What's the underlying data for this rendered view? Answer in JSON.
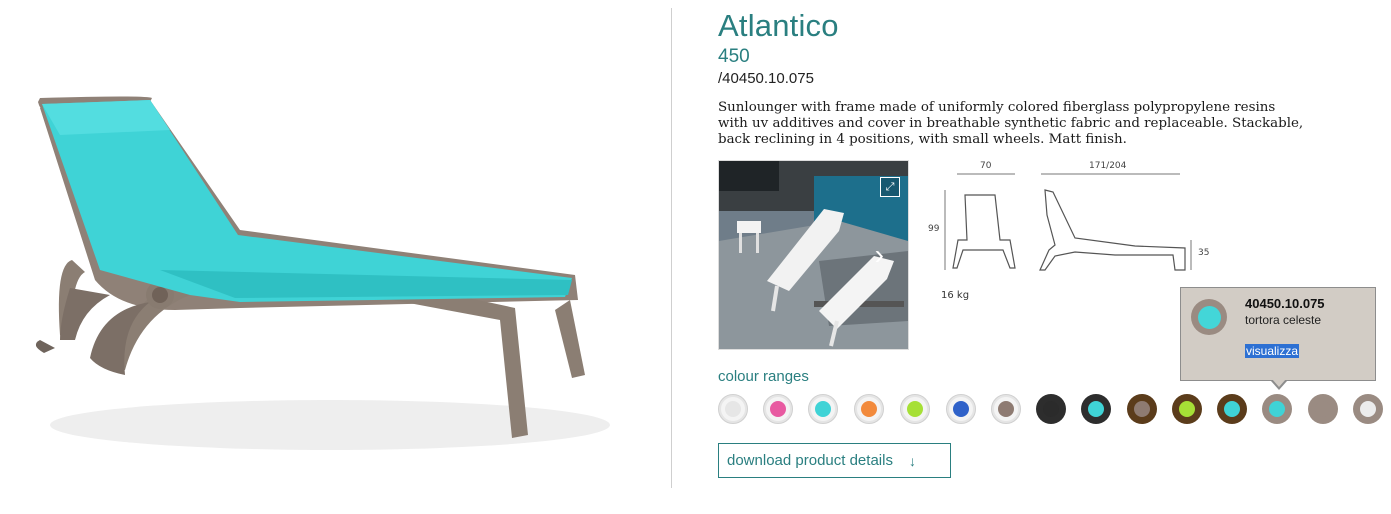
{
  "product": {
    "title": "Atlantico",
    "model": "450",
    "code": "/40450.10.075",
    "description": "Sunlounger with frame made of uniformly colored fiberglass polypropylene resins with uv additives and cover in breathable synthetic fabric and replaceable. Stackable, back reclining in 4 positions, with small wheels. Matt finish."
  },
  "dimensions": {
    "width": "70",
    "length": "171/204",
    "height": "99",
    "seat_height": "35",
    "weight": "16 kg"
  },
  "colour_ranges": {
    "label": "colour ranges",
    "swatches": [
      {
        "ring": "#e5e5e5",
        "fill": "#e6e6e6"
      },
      {
        "ring": "#e5e5e5",
        "fill": "#e85aa1"
      },
      {
        "ring": "#e5e5e5",
        "fill": "#3fd3d6"
      },
      {
        "ring": "#e5e5e5",
        "fill": "#f28a3c"
      },
      {
        "ring": "#e5e5e5",
        "fill": "#a6e036"
      },
      {
        "ring": "#e5e5e5",
        "fill": "#2f62c9"
      },
      {
        "ring": "#e5e5e5",
        "fill": "#8e7b72"
      },
      {
        "ring": "#2d2d2d",
        "fill": "#2b2b2b"
      },
      {
        "ring": "#2d2d2d",
        "fill": "#3fd3d6"
      },
      {
        "ring": "#5b3c1b",
        "fill": "#8e7b72"
      },
      {
        "ring": "#5b3c1b",
        "fill": "#a6e036"
      },
      {
        "ring": "#5b3c1b",
        "fill": "#3fd3d6"
      },
      {
        "ring": "#9a8b82",
        "fill": "#3fd3d6"
      },
      {
        "ring": "#9a8b82",
        "fill": "#9a8b82"
      },
      {
        "ring": "#9a8b82",
        "fill": "#ececec"
      }
    ]
  },
  "tooltip": {
    "code": "40450.10.075",
    "name": "tortora celeste",
    "link": "visualizza"
  },
  "download": {
    "label": "download product details"
  },
  "colors": {
    "accent": "#2a7f80",
    "frame": "#9a8b82",
    "fabric": "#3fd3d6"
  },
  "icons": {
    "expand": "expand-icon",
    "next": "chevron-right-icon",
    "download": "arrow-down-icon"
  }
}
